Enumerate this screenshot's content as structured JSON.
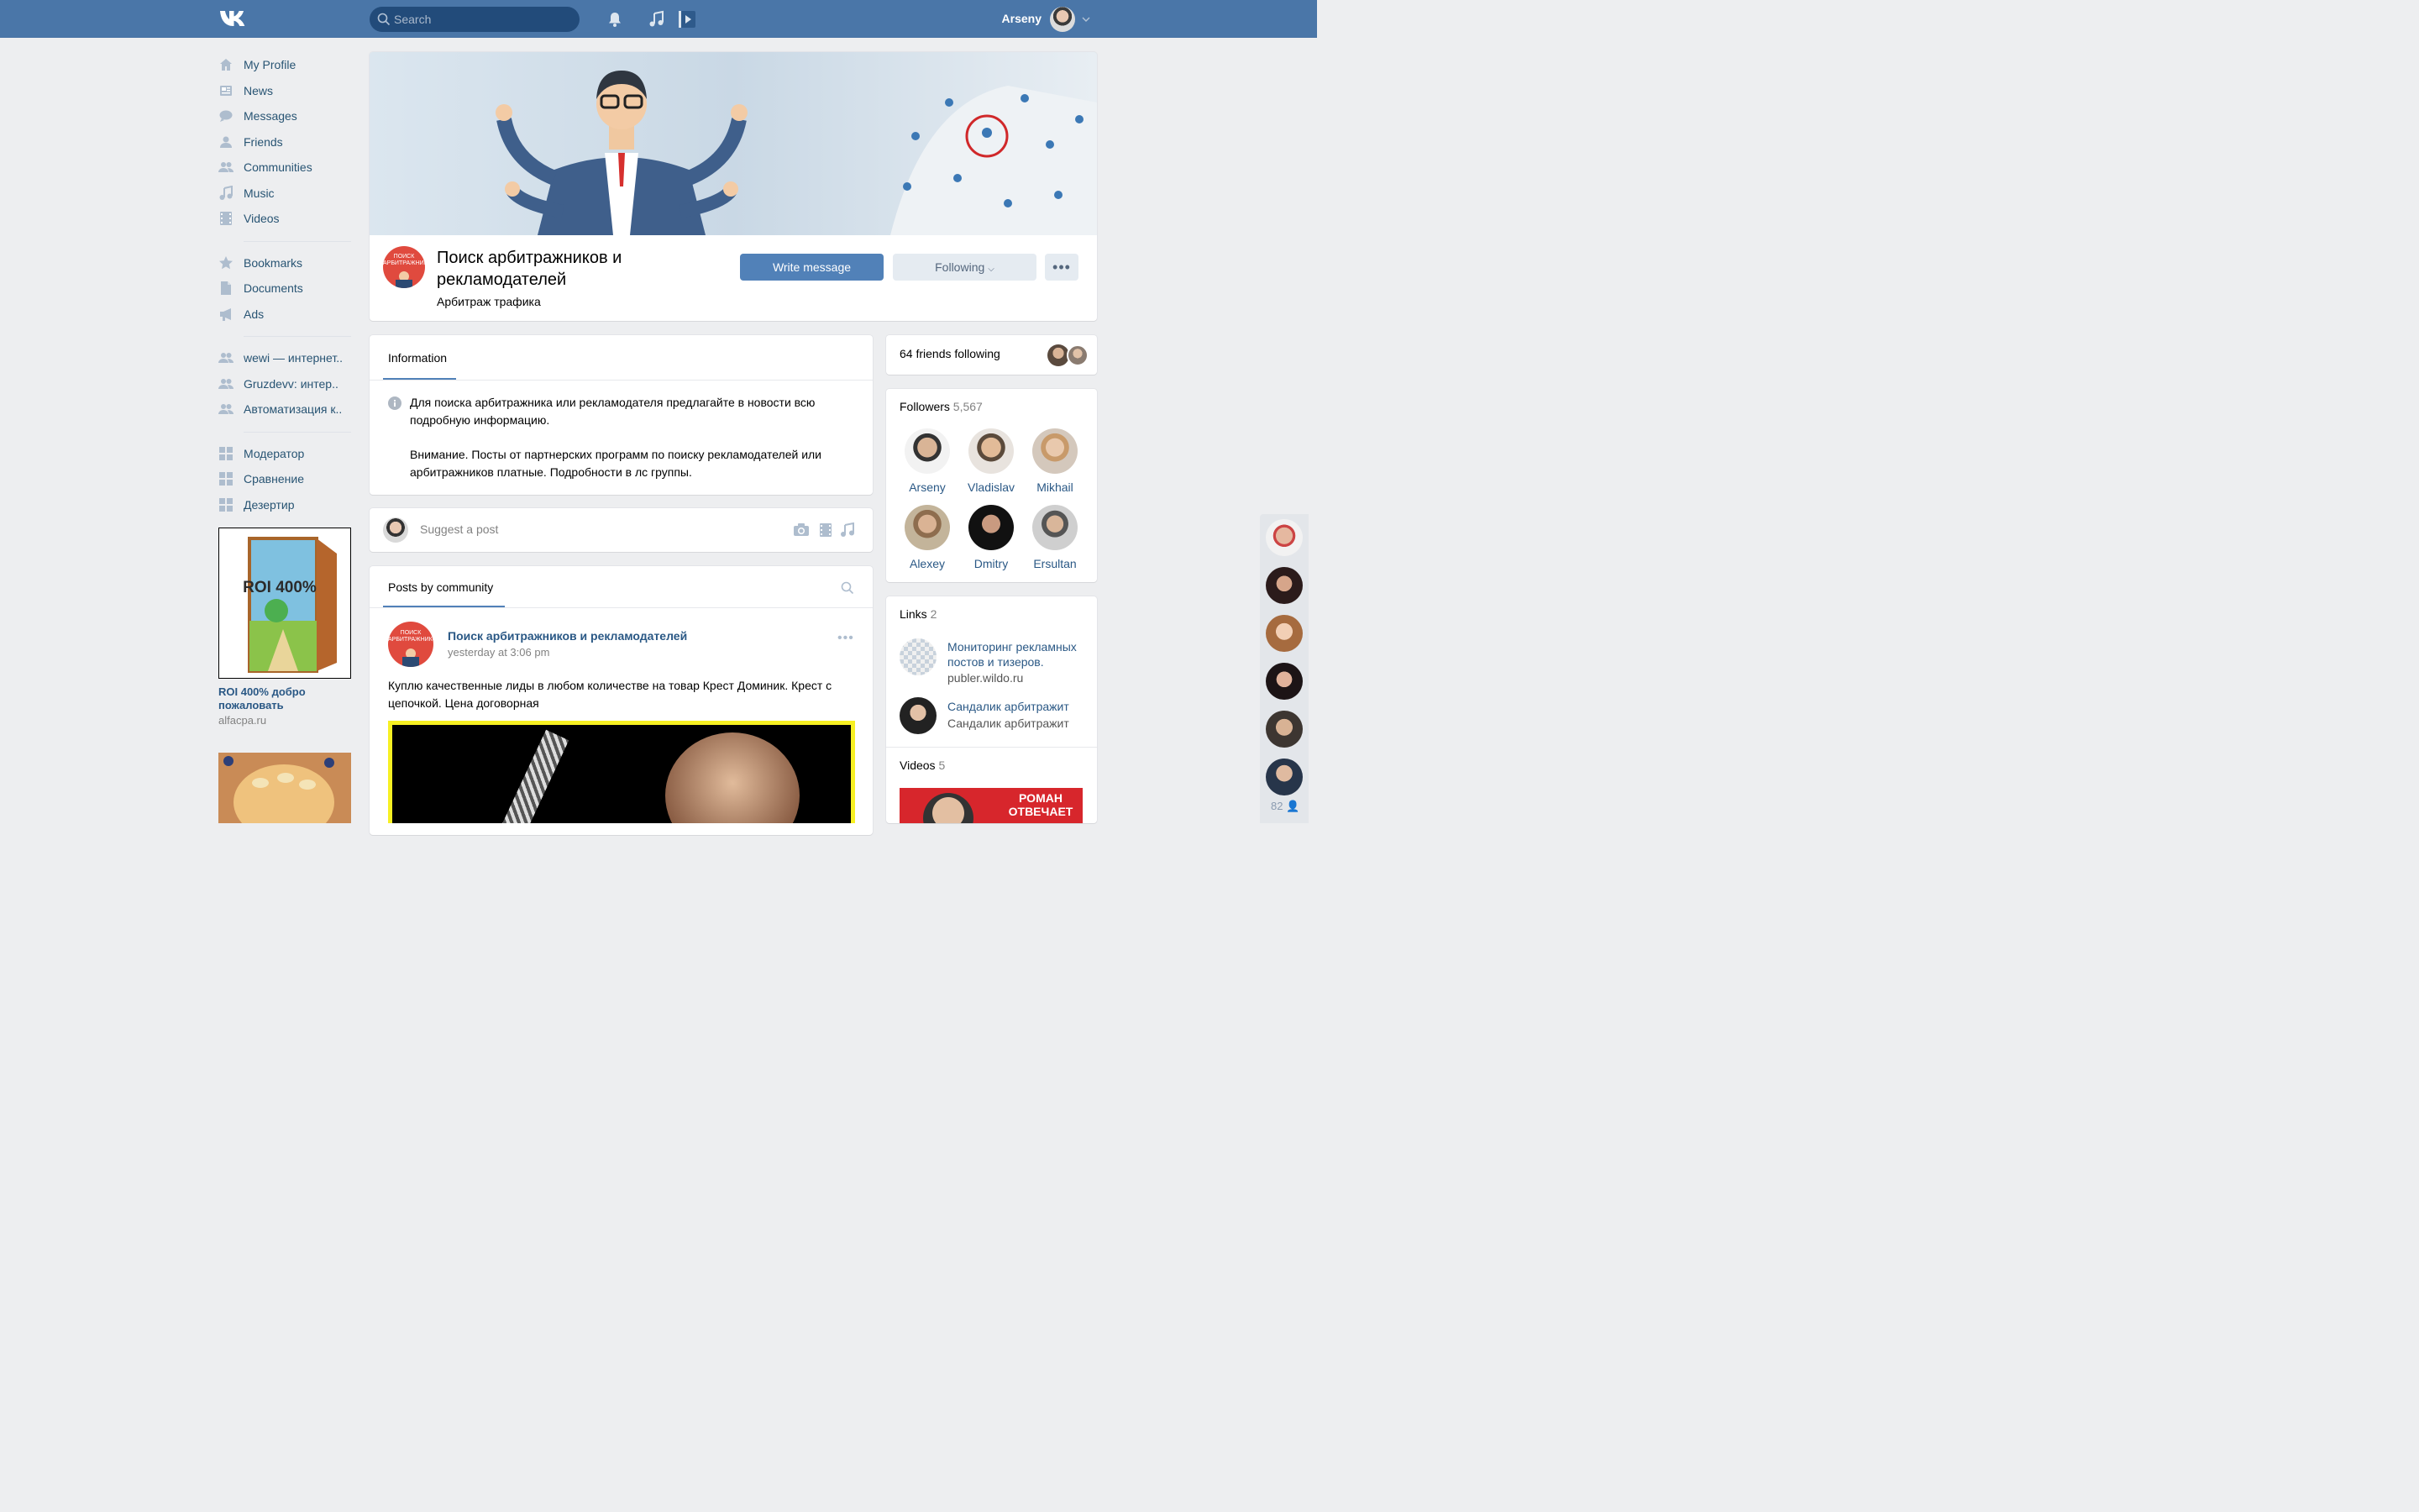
{
  "header": {
    "search_placeholder": "Search",
    "user_name": "Arseny",
    "icons": [
      "vk-logo-icon",
      "search-icon",
      "bell-icon",
      "music-icon",
      "video-icon",
      "chevron-down-icon"
    ]
  },
  "sidebar": {
    "main": [
      {
        "label": "My Profile",
        "icon": "home-icon"
      },
      {
        "label": "News",
        "icon": "news-icon"
      },
      {
        "label": "Messages",
        "icon": "messages-icon"
      },
      {
        "label": "Friends",
        "icon": "friend-icon"
      },
      {
        "label": "Communities",
        "icon": "communities-icon"
      },
      {
        "label": "Music",
        "icon": "music-icon"
      },
      {
        "label": "Videos",
        "icon": "video-icon"
      }
    ],
    "secondary": [
      {
        "label": "Bookmarks",
        "icon": "star-icon"
      },
      {
        "label": "Documents",
        "icon": "document-icon"
      },
      {
        "label": "Ads",
        "icon": "megaphone-icon"
      }
    ],
    "groups": [
      {
        "label": "wewi — интернет..",
        "icon": "group-icon"
      },
      {
        "label": "Gruzdevv: интер..",
        "icon": "group-icon"
      },
      {
        "label": "Автоматизация к..",
        "icon": "group-icon"
      }
    ],
    "apps": [
      {
        "label": "Модератор",
        "icon": "app-grid-icon"
      },
      {
        "label": "Сравнение",
        "icon": "app-grid-icon"
      },
      {
        "label": "Дезертир",
        "icon": "app-grid-icon"
      }
    ],
    "ad": {
      "title": "ROI 400% добро пожаловать",
      "url": "alfacpa.ru",
      "image_text": "ROI 400%"
    }
  },
  "community": {
    "name": "Поиск арбитражников и рекламодателей",
    "status": "Арбитраж трафика",
    "avatar_text": "ПОИСК АРБИТРАЖНИКОВ",
    "write_message": "Write message",
    "following": "Following"
  },
  "info": {
    "tab": "Information",
    "paragraph1": "Для поиска арбитражника или рекламодателя предлагайте в новости всю подробную информацию.",
    "paragraph2": "Внимание. Посты от партнерских программ по поиску рекламодателей или арбитражников платные. Подробности в лс группы."
  },
  "suggest": {
    "placeholder": "Suggest a post"
  },
  "posts": {
    "tab": "Posts by community",
    "post": {
      "author": "Поиск арбитражников и рекламодателей",
      "time": "yesterday at 3:06 pm",
      "text": "Куплю качественные лиды в любом количестве на товар Крест Доминик. Крест с цепочкой. Цена договорная"
    }
  },
  "right": {
    "friends_following": "64 friends following",
    "followers": {
      "title": "Followers",
      "count": "5,567",
      "people": [
        "Arseny",
        "Vladislav",
        "Mikhail",
        "Alexey",
        "Dmitry",
        "Ersultan"
      ]
    },
    "links": {
      "title": "Links",
      "count": "2",
      "items": [
        {
          "title": "Мониторинг рекламных постов и тизеров.",
          "sub": "publer.wildo.ru"
        },
        {
          "title": "Сандалик арбитражит",
          "sub": "Сандалик арбитражит"
        }
      ]
    },
    "videos": {
      "title": "Videos",
      "count": "5",
      "thumb_text": "РОМАН ОТВЕЧАЕТ"
    }
  },
  "rail": {
    "online_count": "82"
  },
  "colors": {
    "header": "#4a76a8",
    "link": "#2a5885",
    "accent": "#5181b8",
    "background": "#edeef0"
  }
}
